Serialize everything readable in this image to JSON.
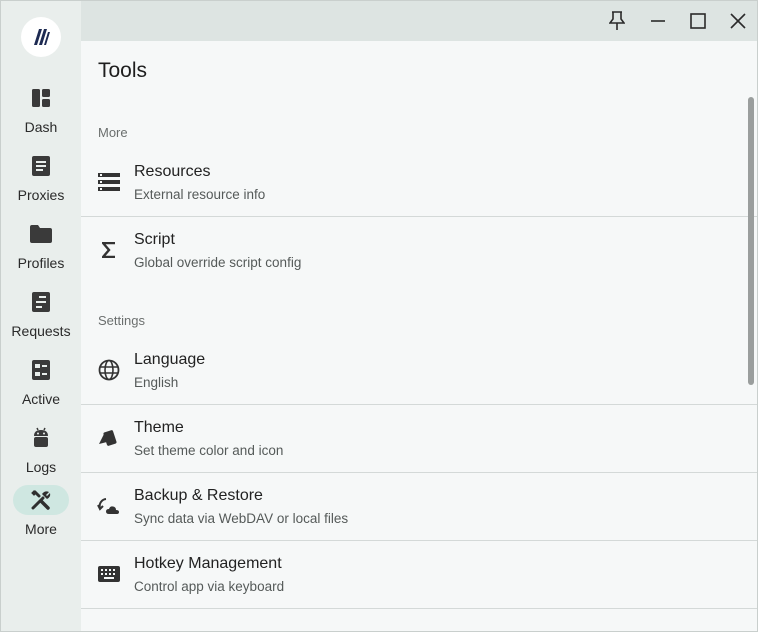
{
  "nav": {
    "items": [
      {
        "label": "Dash",
        "icon": "dashboard-icon"
      },
      {
        "label": "Proxies",
        "icon": "proxies-icon"
      },
      {
        "label": "Profiles",
        "icon": "folder-icon"
      },
      {
        "label": "Requests",
        "icon": "requests-icon"
      },
      {
        "label": "Active",
        "icon": "connections-icon"
      },
      {
        "label": "Logs",
        "icon": "android-icon"
      },
      {
        "label": "More",
        "icon": "tools-icon"
      }
    ],
    "active": "More"
  },
  "titlebar": {
    "buttons": [
      "pin-icon",
      "minimize-icon",
      "maximize-icon",
      "close-icon"
    ]
  },
  "page": {
    "title": "Tools",
    "sections": [
      {
        "label": "More",
        "items": [
          {
            "title": "Resources",
            "subtitle": "External resource info",
            "icon": "storage-icon"
          },
          {
            "title": "Script",
            "subtitle": "Global override script config",
            "icon": "sigma-icon"
          }
        ]
      },
      {
        "label": "Settings",
        "items": [
          {
            "title": "Language",
            "subtitle": "English",
            "icon": "globe-icon"
          },
          {
            "title": "Theme",
            "subtitle": "Set theme color and icon",
            "icon": "palette-icon"
          },
          {
            "title": "Backup & Restore",
            "subtitle": "Sync data via WebDAV or local files",
            "icon": "cloud-sync-icon"
          },
          {
            "title": "Hotkey Management",
            "subtitle": "Control app via keyboard",
            "icon": "keyboard-icon"
          }
        ]
      }
    ]
  },
  "colors": {
    "sidebar_bg": "#e9eeec",
    "titlebar_bg": "#dde4e2",
    "content_bg": "#f6f8f8",
    "active_pill": "#cfe7e1"
  }
}
